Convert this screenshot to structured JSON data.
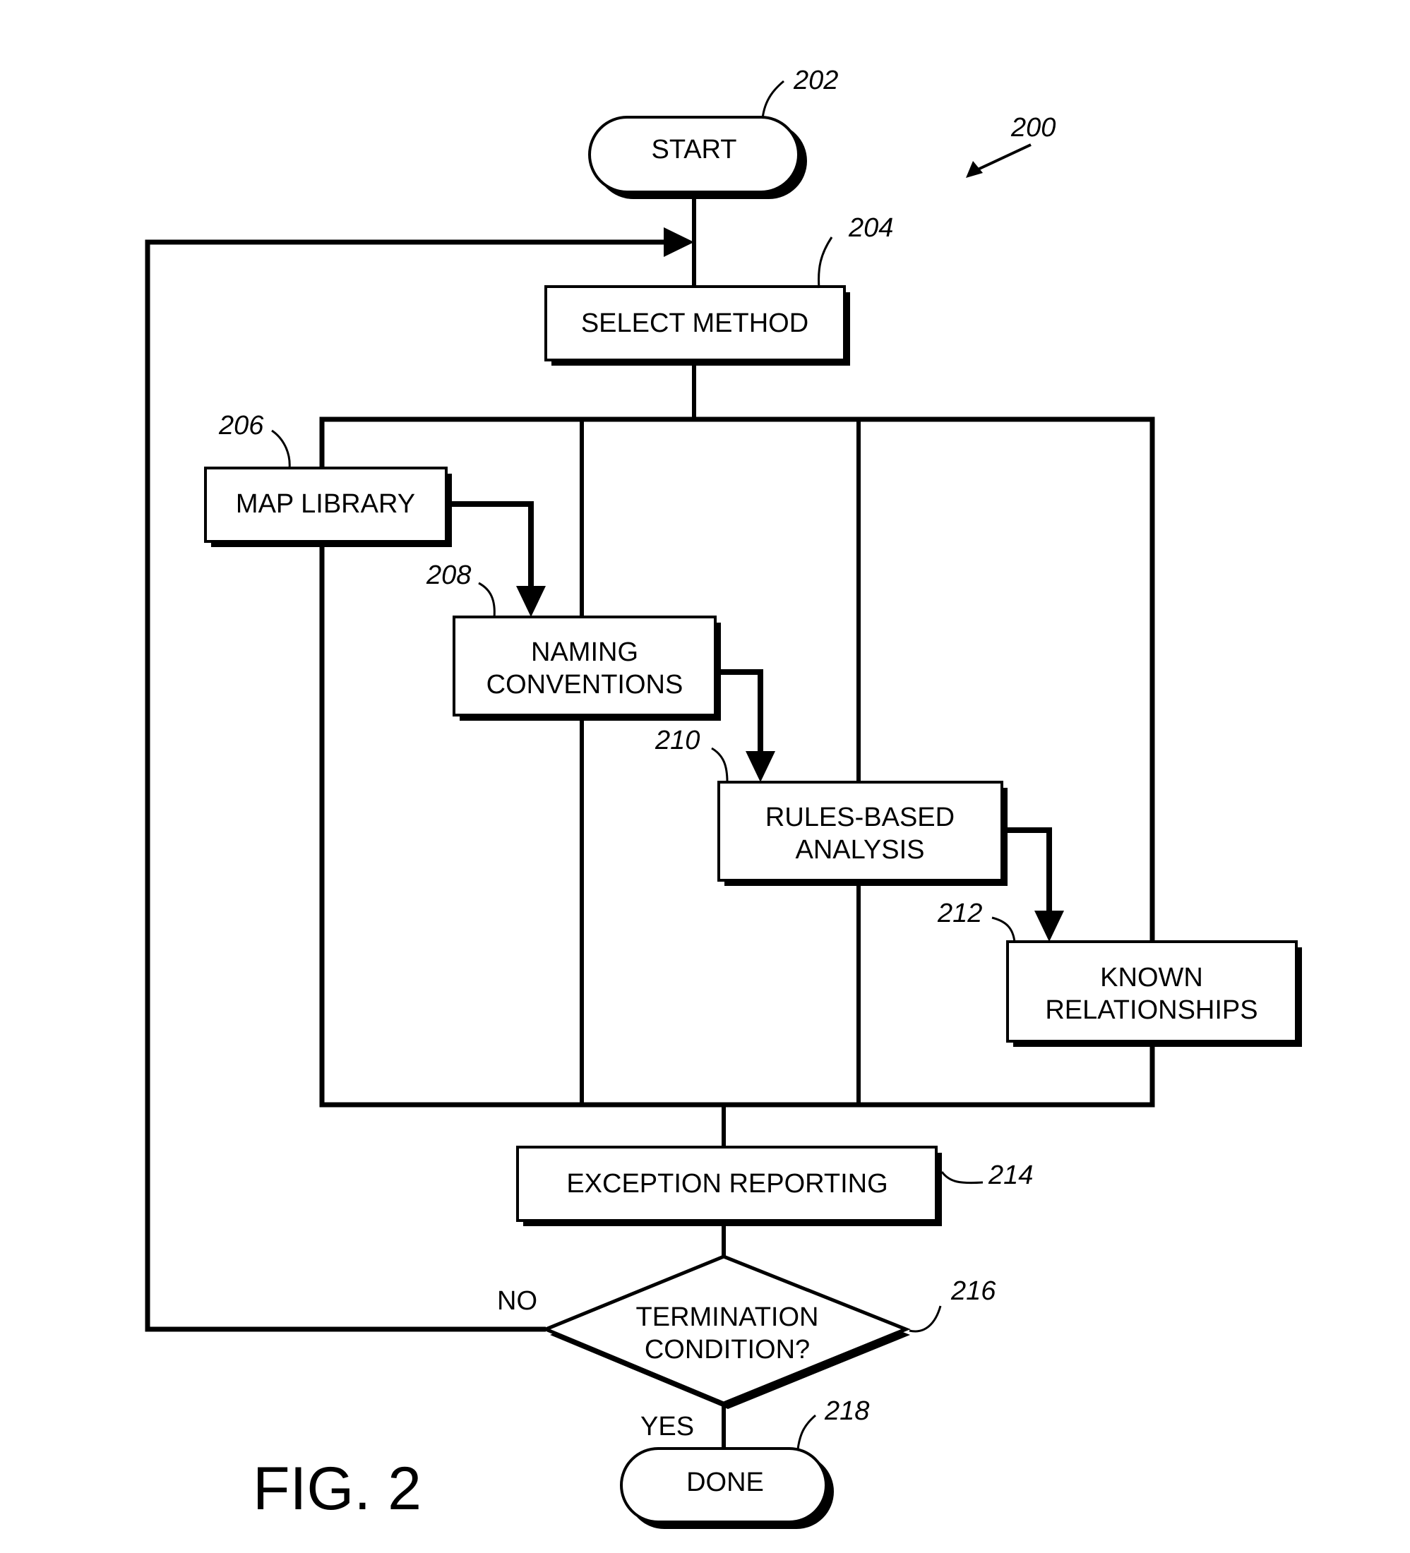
{
  "figure": {
    "label": "FIG. 2",
    "ref": "200"
  },
  "nodes": {
    "start": {
      "ref": "202",
      "label": "START"
    },
    "select_method": {
      "ref": "204",
      "label": "SELECT METHOD"
    },
    "map_library": {
      "ref": "206",
      "label": "MAP LIBRARY"
    },
    "naming_conventions": {
      "ref": "208",
      "lines": [
        "NAMING",
        "CONVENTIONS"
      ]
    },
    "rules_based_analysis": {
      "ref": "210",
      "lines": [
        "RULES-BASED",
        "ANALYSIS"
      ]
    },
    "known_relationships": {
      "ref": "212",
      "lines": [
        "KNOWN",
        "RELATIONSHIPS"
      ]
    },
    "exception_reporting": {
      "ref": "214",
      "label": "EXCEPTION REPORTING"
    },
    "termination_condition": {
      "ref": "216",
      "lines": [
        "TERMINATION",
        "CONDITION?"
      ],
      "no_label": "NO",
      "yes_label": "YES"
    },
    "done": {
      "ref": "218",
      "label": "DONE"
    }
  },
  "edges": [
    {
      "from": "start",
      "to": "select_method"
    },
    {
      "from": "select_method",
      "to": "map_library"
    },
    {
      "from": "select_method",
      "to": "naming_conventions"
    },
    {
      "from": "select_method",
      "to": "rules_based_analysis"
    },
    {
      "from": "select_method",
      "to": "known_relationships"
    },
    {
      "from": "map_library",
      "to": "naming_conventions"
    },
    {
      "from": "naming_conventions",
      "to": "rules_based_analysis"
    },
    {
      "from": "rules_based_analysis",
      "to": "known_relationships"
    },
    {
      "from": "map_library",
      "to": "exception_reporting"
    },
    {
      "from": "naming_conventions",
      "to": "exception_reporting"
    },
    {
      "from": "rules_based_analysis",
      "to": "exception_reporting"
    },
    {
      "from": "known_relationships",
      "to": "exception_reporting"
    },
    {
      "from": "exception_reporting",
      "to": "termination_condition"
    },
    {
      "from": "termination_condition",
      "to": "select_method",
      "label": "NO"
    },
    {
      "from": "termination_condition",
      "to": "done",
      "label": "YES"
    }
  ]
}
